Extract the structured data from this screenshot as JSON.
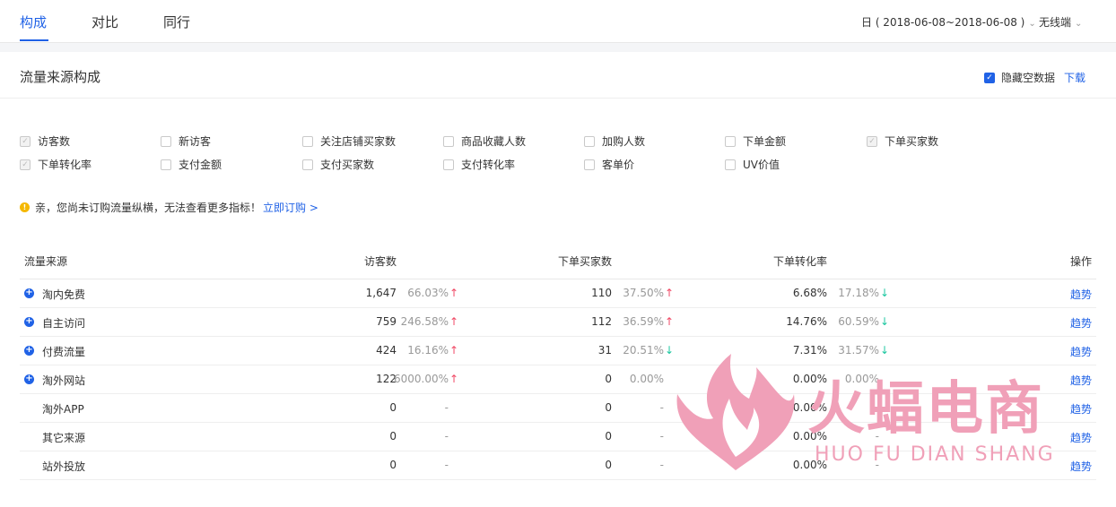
{
  "tabs": [
    {
      "label": "构成"
    },
    {
      "label": "对比"
    },
    {
      "label": "同行"
    }
  ],
  "filters": {
    "date_range": "日 ( 2018-06-08~2018-06-08 )",
    "device": "无线端"
  },
  "section": {
    "title": "流量来源构成",
    "hide_empty_label": "隐藏空数据",
    "download_label": "下载"
  },
  "metrics": [
    {
      "label": "访客数",
      "checked": true
    },
    {
      "label": "新访客",
      "checked": false
    },
    {
      "label": "关注店铺买家数",
      "checked": false
    },
    {
      "label": "商品收藏人数",
      "checked": false
    },
    {
      "label": "加购人数",
      "checked": false
    },
    {
      "label": "下单金额",
      "checked": false
    },
    {
      "label": "下单买家数",
      "checked": true
    },
    {
      "label": "下单转化率",
      "checked": true
    },
    {
      "label": "支付金额",
      "checked": false
    },
    {
      "label": "支付买家数",
      "checked": false
    },
    {
      "label": "支付转化率",
      "checked": false
    },
    {
      "label": "客单价",
      "checked": false
    },
    {
      "label": "UV价值",
      "checked": false
    }
  ],
  "notice": {
    "text": "亲，您尚未订购流量纵横，无法查看更多指标！",
    "link": "立即订购 >"
  },
  "table": {
    "headers": {
      "source": "流量来源",
      "visitors": "访客数",
      "buyers": "下单买家数",
      "conversion": "下单转化率",
      "action": "操作"
    },
    "rows": [
      {
        "source": "淘内免费",
        "expand": true,
        "visitors": "1,647",
        "visitors_pct": "66.03%",
        "visitors_dir": "up",
        "buyers": "110",
        "buyers_pct": "37.50%",
        "buyers_dir": "up",
        "conv": "6.68%",
        "conv_pct": "17.18%",
        "conv_dir": "down",
        "action": "趋势"
      },
      {
        "source": "自主访问",
        "expand": true,
        "visitors": "759",
        "visitors_pct": "246.58%",
        "visitors_dir": "up",
        "buyers": "112",
        "buyers_pct": "36.59%",
        "buyers_dir": "up",
        "conv": "14.76%",
        "conv_pct": "60.59%",
        "conv_dir": "down",
        "action": "趋势"
      },
      {
        "source": "付费流量",
        "expand": true,
        "visitors": "424",
        "visitors_pct": "16.16%",
        "visitors_dir": "up",
        "buyers": "31",
        "buyers_pct": "20.51%",
        "buyers_dir": "down",
        "conv": "7.31%",
        "conv_pct": "31.57%",
        "conv_dir": "down",
        "action": "趋势"
      },
      {
        "source": "淘外网站",
        "expand": true,
        "visitors": "122",
        "visitors_pct": "6000.00%",
        "visitors_dir": "up",
        "buyers": "0",
        "buyers_pct": "0.00%",
        "buyers_dir": "",
        "conv": "0.00%",
        "conv_pct": "0.00%",
        "conv_dir": "",
        "action": "趋势"
      },
      {
        "source": "淘外APP",
        "expand": false,
        "visitors": "0",
        "visitors_pct": "-",
        "visitors_dir": "",
        "buyers": "0",
        "buyers_pct": "-",
        "buyers_dir": "",
        "conv": "0.00%",
        "conv_pct": "-",
        "conv_dir": "",
        "action": "趋势"
      },
      {
        "source": "其它来源",
        "expand": false,
        "visitors": "0",
        "visitors_pct": "-",
        "visitors_dir": "",
        "buyers": "0",
        "buyers_pct": "-",
        "buyers_dir": "",
        "conv": "0.00%",
        "conv_pct": "-",
        "conv_dir": "",
        "action": "趋势"
      },
      {
        "source": "站外投放",
        "expand": false,
        "visitors": "0",
        "visitors_pct": "-",
        "visitors_dir": "",
        "buyers": "0",
        "buyers_pct": "-",
        "buyers_dir": "",
        "conv": "0.00%",
        "conv_pct": "-",
        "conv_dir": "",
        "action": "趋势"
      }
    ]
  },
  "watermark": {
    "cn": "火蝠电商",
    "en": "HUO FU DIAN SHANG"
  },
  "colors": {
    "accent": "#2062e6",
    "up": "#f04864",
    "down": "#1cc7a0",
    "watermark": "#f0a0b8"
  }
}
